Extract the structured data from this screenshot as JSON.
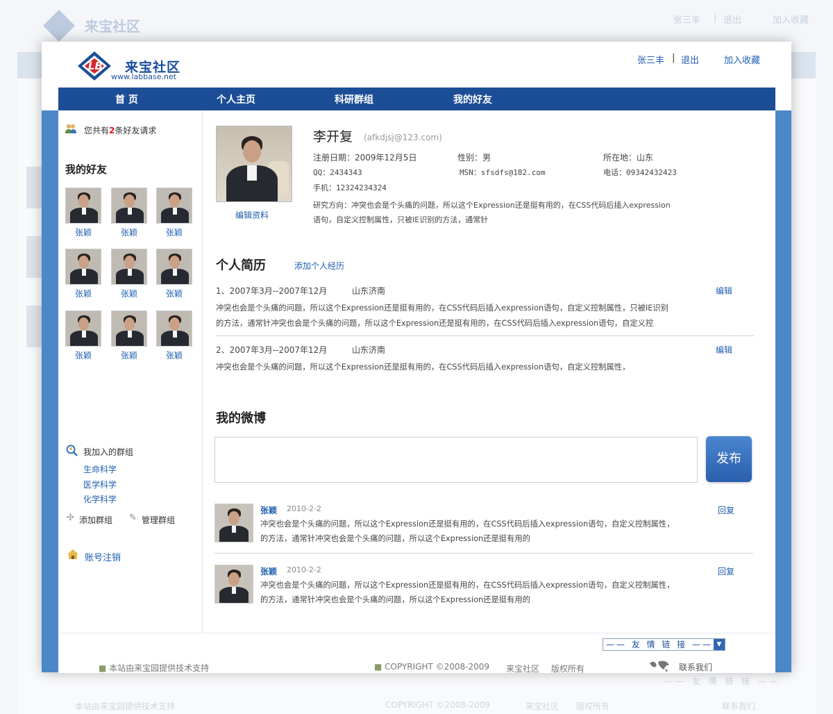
{
  "site": {
    "name": "来宝社区",
    "url": "www.labbase.net",
    "logo_letters": "LB"
  },
  "top_links": {
    "user": "张三丰",
    "sep": "|",
    "logout": "退出",
    "favorite": "加入收藏"
  },
  "nav": [
    "首 页",
    "个人主页",
    "科研群组",
    "我的好友"
  ],
  "sidebar": {
    "friend_request": {
      "prefix": "您共有",
      "count": "2",
      "suffix": "条好友请求"
    },
    "friends_title": "我的好友",
    "friends": [
      "张颖",
      "张颖",
      "张颖",
      "张颖",
      "张颖",
      "张颖",
      "张颖",
      "张颖",
      "张颖"
    ],
    "groups_title": "我加入的群组",
    "groups": [
      "生命科学",
      "医学科学",
      "化学科学"
    ],
    "add_group": "添加群组",
    "manage_group": "管理群组",
    "account_cancel": "账号注销"
  },
  "profile": {
    "name": "李开复",
    "email": "(afkdjsj@123.com)",
    "edit_label": "编辑资料",
    "reg_date": "注册日期：2009年12月5日",
    "gender": "性别：男",
    "location": "所在地：山东",
    "qq": "QQ：2434343",
    "msn": "MSN：sfsdfs@182.com",
    "phone": "电话：09342432423",
    "mobile": "手机：12324234324",
    "research_1": "研究方向：冲突也会是个头痛的问题，所以这个Expression还是挺有用的，在CSS代码后插入expression",
    "research_2": "语句，自定义控制属性，只被IE识别的方法，通常针"
  },
  "resume": {
    "title": "个人简历",
    "add_label": "添加个人经历",
    "items": [
      {
        "period": "1、2007年3月--2007年12月",
        "place": "山东济南",
        "edit": "编辑",
        "line1": "冲突也会是个头痛的问题，所以这个Expression还是挺有用的，在CSS代码后插入expression语句，自定义控制属性，只被IE识别",
        "line2": "的方法，通常针冲突也会是个头痛的问题，所以这个Expression还是挺有用的，在CSS代码后插入expression语句，自定义控"
      },
      {
        "period": "2、2007年3月--2007年12月",
        "place": "山东济南",
        "edit": "编辑",
        "line1": "冲突也会是个头痛的问题，所以这个Expression还是挺有用的，在CSS代码后插入expression语句，自定义控制属性，",
        "line2": ""
      }
    ]
  },
  "weibo": {
    "title": "我的微博",
    "input_value": "",
    "publish": "发布",
    "posts": [
      {
        "author": "张颖",
        "date": "2010-2-2",
        "reply": "回复",
        "line1": "冲突也会是个头痛的问题，所以这个Expression还是挺有用的，在CSS代码后插入expression语句，自定义控制属性，",
        "line2": "的方法，通常针冲突也会是个头痛的问题，所以这个Expression还是挺有用的"
      },
      {
        "author": "张颖",
        "date": "2010-2-2",
        "reply": "回复",
        "line1": "冲突也会是个头痛的问题，所以这个Expression还是挺有用的，在CSS代码后插入expression语句，自定义控制属性，",
        "line2": "的方法，通常针冲突也会是个头痛的问题，所以这个Expression还是挺有用的"
      }
    ]
  },
  "footer": {
    "links_select": "—— 友 情 链 接 ——",
    "support": "本站由来宝园提供技术支持",
    "copyright": "COPYRIGHT ©2008-2009",
    "rights_site": "来宝社区",
    "rights": "版权所有",
    "contact": "联系我们"
  },
  "colors": {
    "nav": "#1c4e97",
    "side_bar": "#4a88c8",
    "link": "#1e5fb0",
    "accent_red": "#e0101a",
    "publish_btn": "#2d66b6"
  },
  "icons": {
    "friend_request": "people-icon",
    "groups": "group-search-icon",
    "add": "plus-icon",
    "manage": "wrench-icon",
    "account": "house-icon",
    "contact": "globe-icon",
    "select": "chevron-down-icon"
  }
}
